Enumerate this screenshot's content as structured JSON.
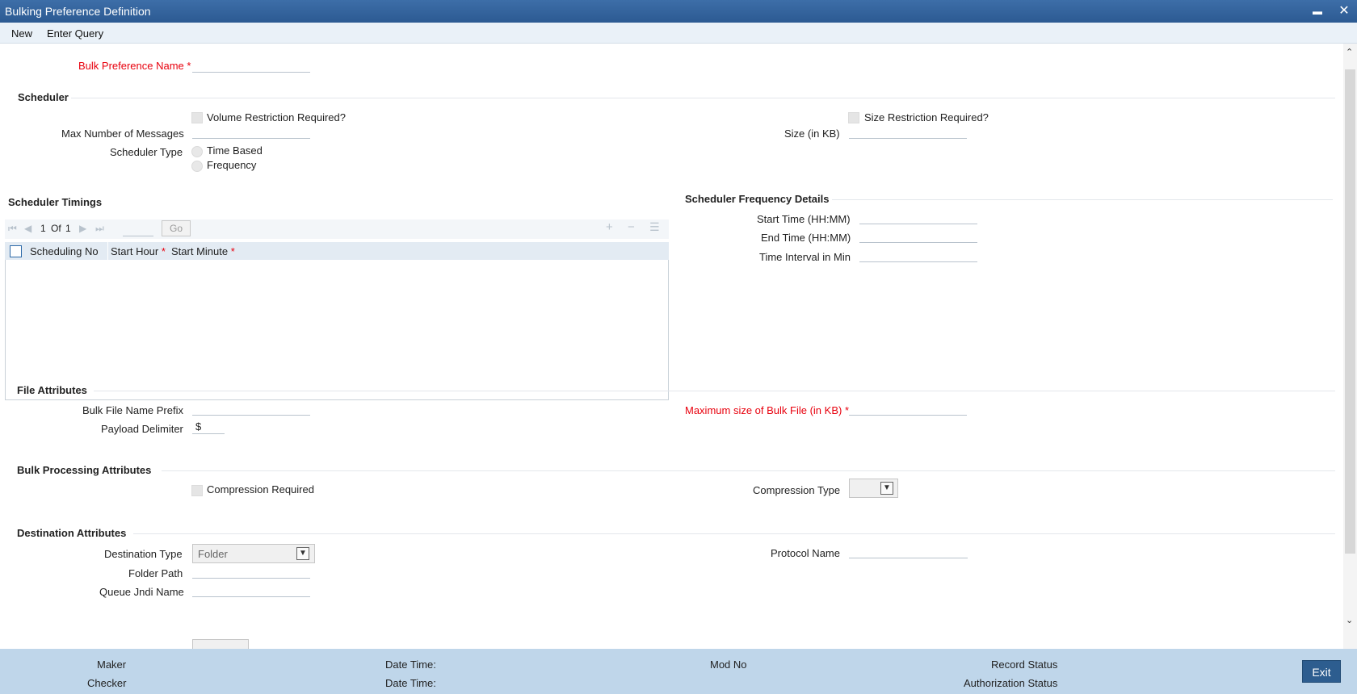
{
  "window": {
    "title": "Bulking Preference Definition",
    "minimize_glyph": "▬",
    "close_glyph": "✕"
  },
  "menu": {
    "new_label": "New",
    "enter_query_label": "Enter Query"
  },
  "form": {
    "bulk_preference_name_label": "Bulk Preference Name",
    "required_mark": "*",
    "scheduler": {
      "title": "Scheduler",
      "volume_restriction_label": "Volume Restriction Required?",
      "size_restriction_label": "Size Restriction Required?",
      "max_messages_label": "Max Number of Messages",
      "size_kb_label": "Size (in KB)",
      "scheduler_type_label": "Scheduler Type",
      "time_based_label": "Time Based",
      "frequency_label": "Frequency"
    },
    "timings": {
      "title": "Scheduler Timings",
      "page_current": "1",
      "page_of": "Of",
      "page_total": "1",
      "go_label": "Go",
      "columns": [
        "Scheduling No",
        "Start Hour",
        "Start Minute"
      ]
    },
    "frequency_details": {
      "title": "Scheduler Frequency Details",
      "start_time_label": "Start Time (HH:MM)",
      "end_time_label": "End Time (HH:MM)",
      "interval_label": "Time Interval in Min"
    },
    "file_attributes": {
      "title": "File Attributes",
      "prefix_label": "Bulk File Name Prefix",
      "max_size_label": "Maximum size of Bulk File (in KB)",
      "delimiter_label": "Payload Delimiter",
      "delimiter_value": "$"
    },
    "bulk_processing": {
      "title": "Bulk Processing Attributes",
      "compression_required_label": "Compression Required",
      "compression_type_label": "Compression Type"
    },
    "destination": {
      "title": "Destination Attributes",
      "destination_type_label": "Destination Type",
      "destination_type_value": "Folder",
      "protocol_name_label": "Protocol Name",
      "folder_path_label": "Folder Path",
      "queue_jndi_label": "Queue Jndi Name"
    }
  },
  "footer": {
    "maker_label": "Maker",
    "checker_label": "Checker",
    "date_time_label": "Date Time:",
    "mod_no_label": "Mod No",
    "record_status_label": "Record Status",
    "auth_status_label": "Authorization Status",
    "exit_label": "Exit"
  },
  "colors": {
    "title_bar": "#2c5a92",
    "required": "#e8000d",
    "footer": "#bfd6ea",
    "exit_button": "#2d5d8f"
  }
}
